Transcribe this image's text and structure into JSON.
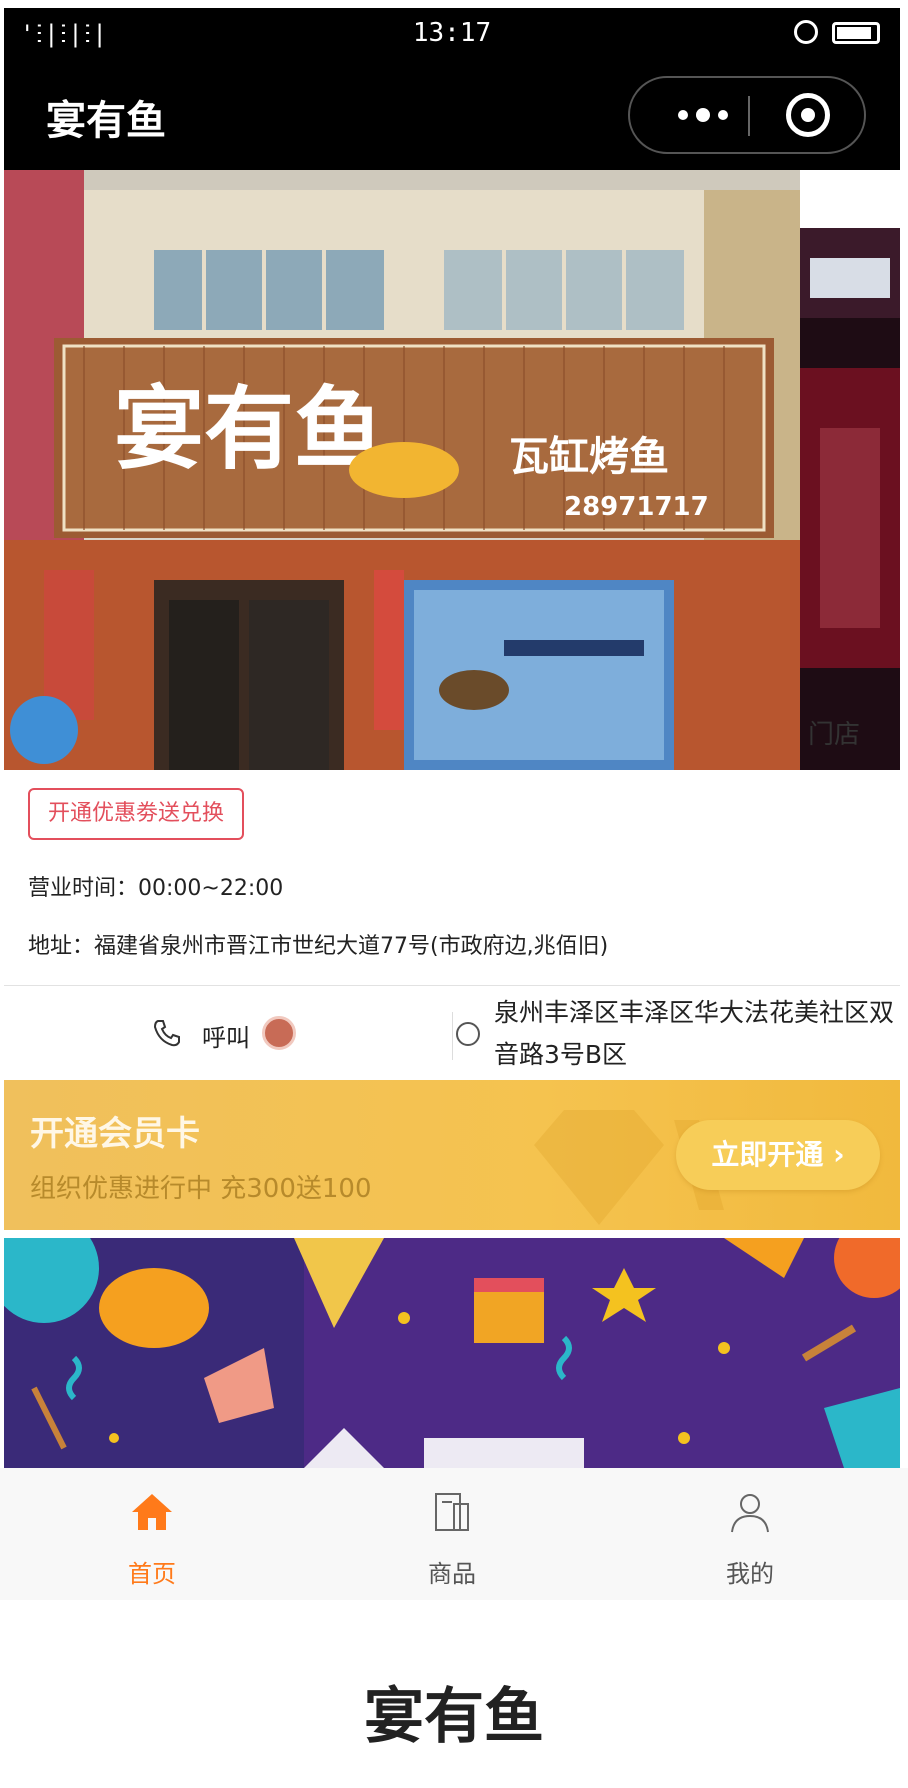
{
  "status_bar": {
    "signal": "'ⵗ|ⵗ|ⵗ|",
    "time": "13:17"
  },
  "nav": {
    "title": "宴有鱼"
  },
  "banner": {
    "shop_sign_name": "宴有鱼",
    "shop_sign_sub": "瓦缸烤鱼",
    "shop_phone": "28971717",
    "next_slide_caption": "门店"
  },
  "info": {
    "promo_tag": "开通优惠劵送兑换",
    "hours": "营业时间：00:00~22:00",
    "address": "地址：福建省泉州市晋江市世纪大道77号(市政府边,兆佰旧)"
  },
  "contact": {
    "call_label": "呼叫",
    "branch": "泉州丰泽区丰泽区华大法花美社区双音路3号B区"
  },
  "member_card": {
    "title": "开通会员卡",
    "subtitle": "组织优惠进行中 充300送100",
    "button": "立即开通 ›"
  },
  "tabs": [
    {
      "label": "首页",
      "icon": "home-icon",
      "active": true
    },
    {
      "label": "商品",
      "icon": "goods-icon",
      "active": false
    },
    {
      "label": "我的",
      "icon": "user-icon",
      "active": false
    }
  ],
  "colors": {
    "accent": "#ff7a1a",
    "promo": "#e34f5c",
    "gold": "#f5c34f"
  },
  "footer": {
    "brand": "宴有鱼"
  }
}
